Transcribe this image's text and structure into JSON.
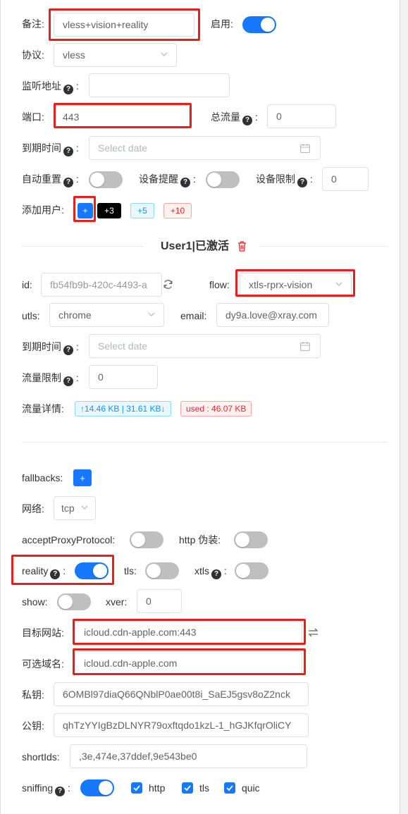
{
  "form": {
    "remark_label": "备注:",
    "remark_value": "vless+vision+reality",
    "enable_label": "启用:",
    "protocol_label": "协议:",
    "protocol_value": "vless",
    "listen_label": "监听地址",
    "port_label": "端口:",
    "port_value": "443",
    "total_traffic_label": "总流量",
    "total_traffic_value": "0",
    "expiry_label": "到期时间",
    "expiry_placeholder": "Select date",
    "auto_reset_label": "自动重置",
    "device_alert_label": "设备提醒",
    "device_limit_label": "设备限制",
    "device_limit_value": "0",
    "add_user_label": "添加用户:",
    "add_buttons": [
      "+",
      "+3",
      "+5",
      "+10"
    ]
  },
  "user": {
    "title": "User1|已激活",
    "id_label": "id:",
    "id_value": "fb54fb9b-420c-4493-a",
    "flow_label": "flow:",
    "flow_value": "xtls-rprx-vision",
    "utls_label": "utls:",
    "utls_value": "chrome",
    "email_label": "email:",
    "email_value": "dy9a.love@xray.com",
    "expiry_label": "到期时间",
    "expiry_placeholder": "Select date",
    "traffic_limit_label": "流量限制",
    "traffic_limit_value": "0",
    "traffic_detail_label": "流量详情:",
    "traffic_updown": "↑14.46 KB | 31.61 KB↓",
    "traffic_used": "used : 46.07 KB"
  },
  "stream": {
    "fallbacks_label": "fallbacks:",
    "fallbacks_button": "+",
    "network_label": "网络:",
    "network_value": "tcp",
    "accept_proxy_label": "acceptProxyProtocol:",
    "http_camouflage_label": "http 伪装:",
    "reality_label": "reality",
    "tls_label": "tls:",
    "xtls_label": "xtls",
    "show_label": "show:",
    "xver_label": "xver:",
    "xver_value": "0",
    "dest_label": "目标网站:",
    "dest_value": "icloud.cdn-apple.com:443",
    "server_names_label": "可选域名:",
    "server_names_value": "icloud.cdn-apple.com",
    "private_key_label": "私钥:",
    "private_key_value": "6OMBl97diaQ66QNblP0ae00t8i_SaEJ5gsv8oZ2nck",
    "public_key_label": "公钥:",
    "public_key_value": "qhTzYYIgBzDLNYR79oxftqdo1kzL-1_hGJKfqrOliCY",
    "short_ids_label": "shortIds:",
    "short_ids_value": ",3e,474e,37ddef,9e543be0",
    "sniffing_label": "sniffing",
    "sniff_options": [
      "http",
      "tls",
      "quic"
    ]
  },
  "colors": {
    "primary": "#1677ff",
    "highlight": "#e8201c",
    "danger": "#f5222d"
  }
}
